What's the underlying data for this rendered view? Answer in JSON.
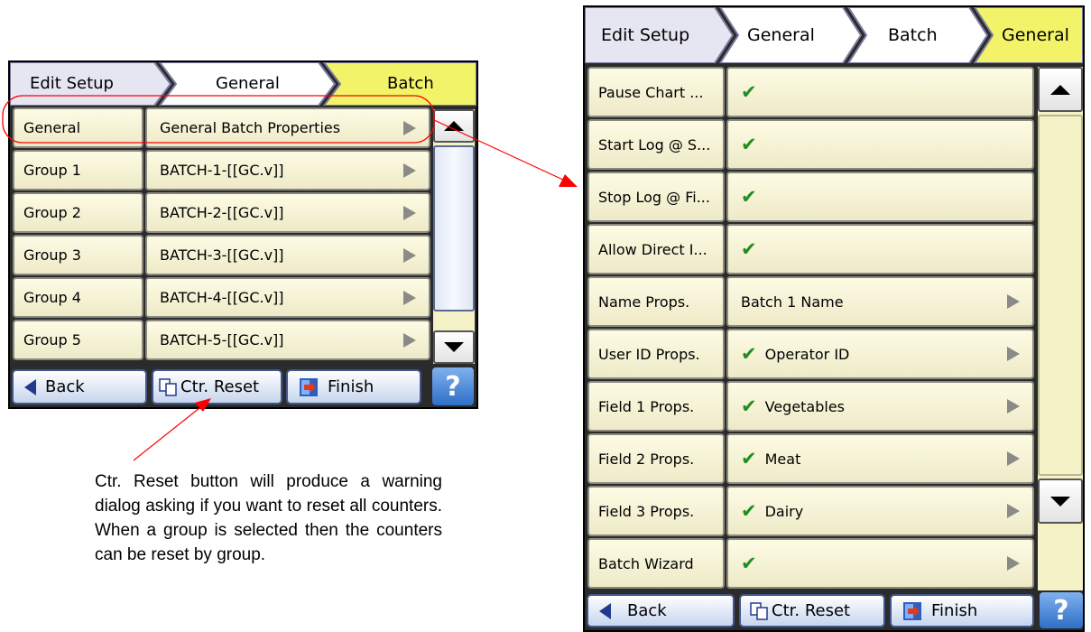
{
  "left_screen": {
    "breadcrumb": [
      "Edit Setup",
      "General",
      "Batch"
    ],
    "rows": [
      {
        "label": "General",
        "value": "General Batch Properties"
      },
      {
        "label": "Group 1",
        "value": "BATCH-1-[[GC.v]]"
      },
      {
        "label": "Group 2",
        "value": "BATCH-2-[[GC.v]]"
      },
      {
        "label": "Group 3",
        "value": "BATCH-3-[[GC.v]]"
      },
      {
        "label": "Group 4",
        "value": "BATCH-4-[[GC.v]]"
      },
      {
        "label": "Group 5",
        "value": "BATCH-5-[[GC.v]]"
      }
    ],
    "toolbar": {
      "back": "Back",
      "reset": "Ctr. Reset",
      "finish": "Finish",
      "help": "?"
    }
  },
  "right_screen": {
    "breadcrumb": [
      "Edit Setup",
      "General",
      "Batch",
      "General"
    ],
    "rows": [
      {
        "label": "Pause Chart ...",
        "value": "",
        "checked": true,
        "arrow": false
      },
      {
        "label": "Start Log @ S...",
        "value": "",
        "checked": true,
        "arrow": false
      },
      {
        "label": "Stop Log @ Fi...",
        "value": "",
        "checked": true,
        "arrow": false
      },
      {
        "label": "Allow Direct I...",
        "value": "",
        "checked": true,
        "arrow": false
      },
      {
        "label": "Name Props.",
        "value": "Batch 1 Name",
        "checked": false,
        "arrow": true
      },
      {
        "label": "User ID Props.",
        "value": "Operator ID",
        "checked": true,
        "arrow": true
      },
      {
        "label": "Field 1 Props.",
        "value": "Vegetables",
        "checked": true,
        "arrow": true
      },
      {
        "label": "Field 2 Props.",
        "value": "Meat",
        "checked": true,
        "arrow": true
      },
      {
        "label": "Field 3 Props.",
        "value": "Dairy",
        "checked": true,
        "arrow": true
      },
      {
        "label": "Batch Wizard",
        "value": "",
        "checked": true,
        "arrow": true
      }
    ],
    "toolbar": {
      "back": "Back",
      "reset": "Ctr. Reset",
      "finish": "Finish",
      "help": "?"
    }
  },
  "caption": "Ctr. Reset button will produce a warning dialog asking if you want to reset all counters. When a group is selected then the counters can be reset by group.",
  "colors": {
    "breadcrumb_active": "#f3f36a",
    "row_fill": "#f7f4d6",
    "check": "#1e8f1e",
    "callout_red": "#ff0000",
    "button_border": "#42568a",
    "help_blue": "#3b7dd8"
  },
  "icons": {
    "back": "back-arrow-icon",
    "reset": "counter-reset-icon",
    "finish": "finish-door-icon",
    "help": "help-icon",
    "check": "check-icon",
    "row_arrow": "chevron-right-icon"
  }
}
